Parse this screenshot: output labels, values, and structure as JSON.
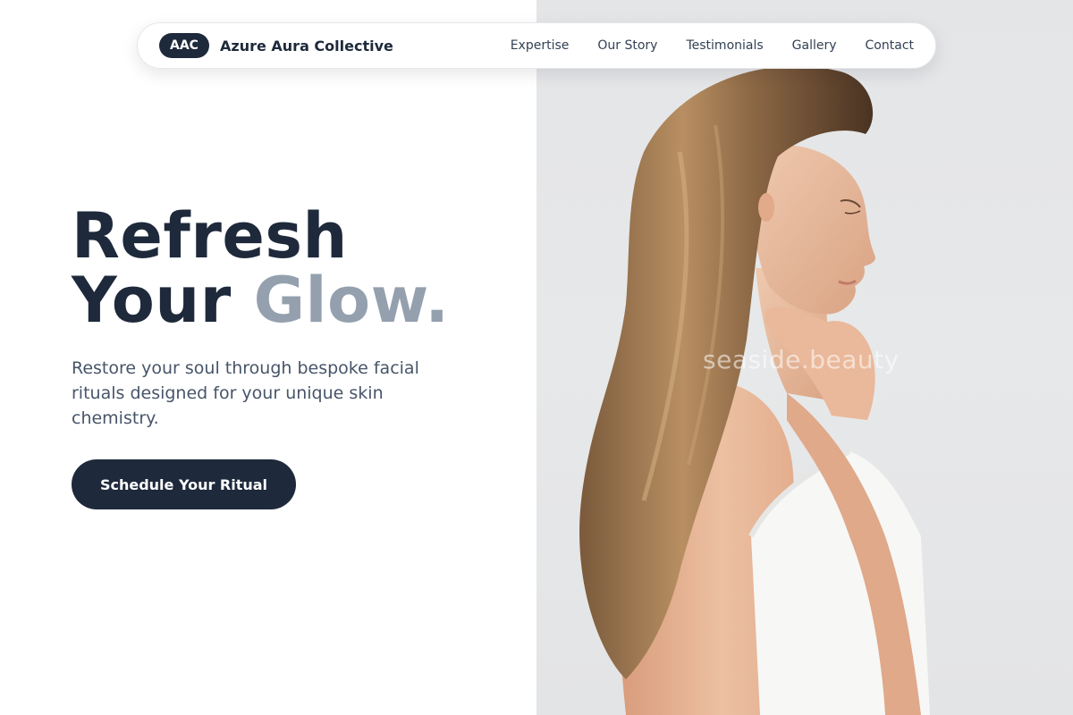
{
  "brand": {
    "logo_text": "AAC",
    "name": "Azure Aura Collective"
  },
  "nav": {
    "items": [
      "Expertise",
      "Our Story",
      "Testimonials",
      "Gallery",
      "Contact"
    ]
  },
  "hero": {
    "title_line1": "Refresh",
    "title_line2_a": "Your ",
    "title_line2_b": "Glow.",
    "subtitle": "Restore your soul through bespoke facial rituals designed for your unique skin chemistry.",
    "cta_label": "Schedule Your Ritual"
  },
  "image": {
    "watermark": "seaside.beauty",
    "subject": "woman-profile-in-towel"
  },
  "colors": {
    "primary": "#1e293b",
    "accent_text": "#94a0ae",
    "body_text": "#475569",
    "photo_bg": "#e5e6e8"
  }
}
